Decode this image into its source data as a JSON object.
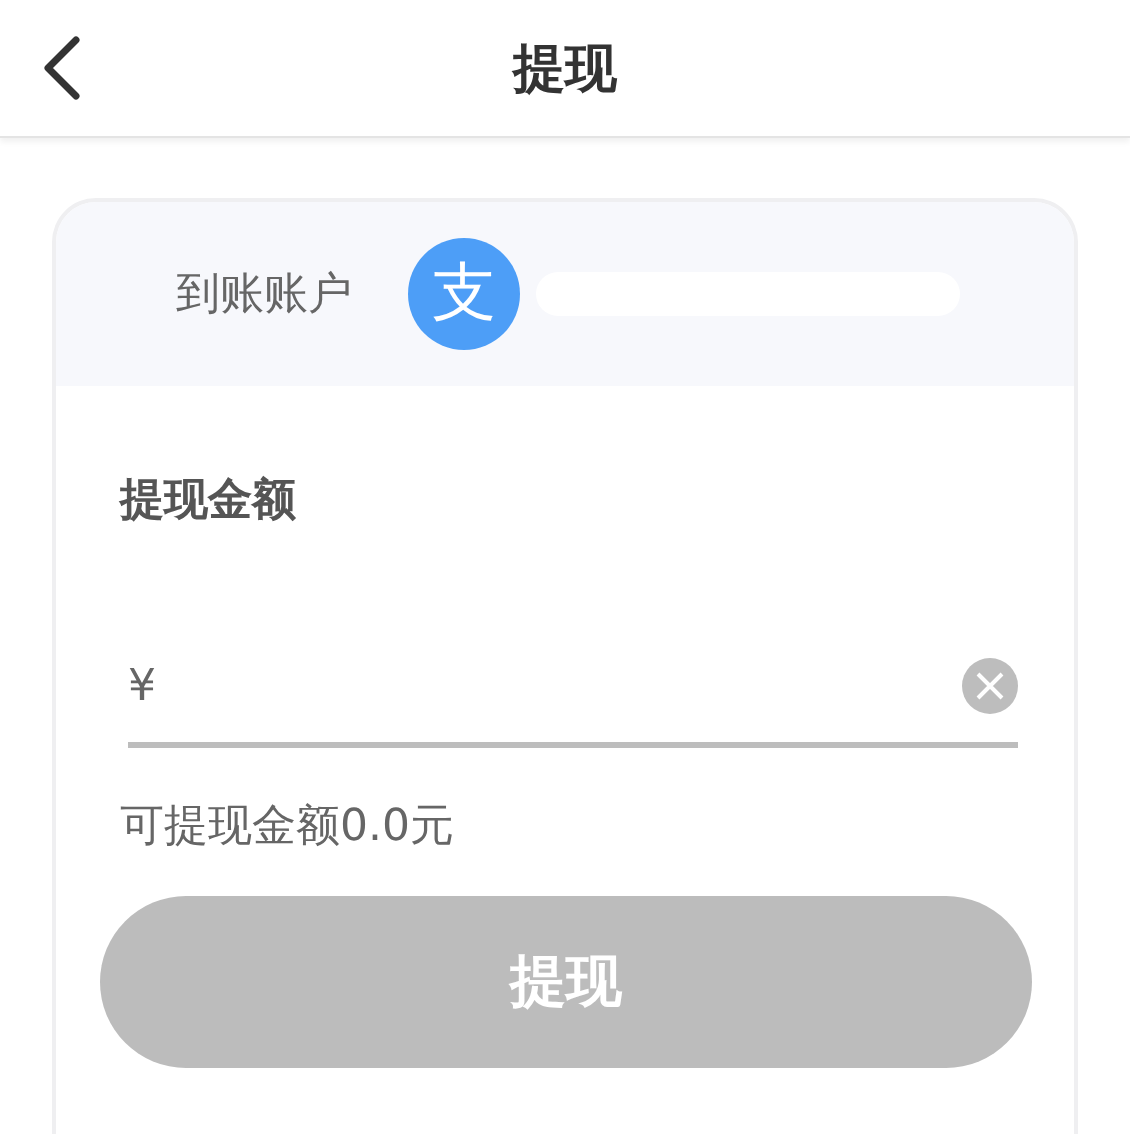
{
  "header": {
    "title": "提现"
  },
  "account": {
    "label": "到账账户",
    "logo_glyph": "支"
  },
  "amount": {
    "heading": "提现金额",
    "currency": "¥",
    "available": "可提现金额0.0元"
  },
  "submit": {
    "label": "提现",
    "disabled": true
  }
}
